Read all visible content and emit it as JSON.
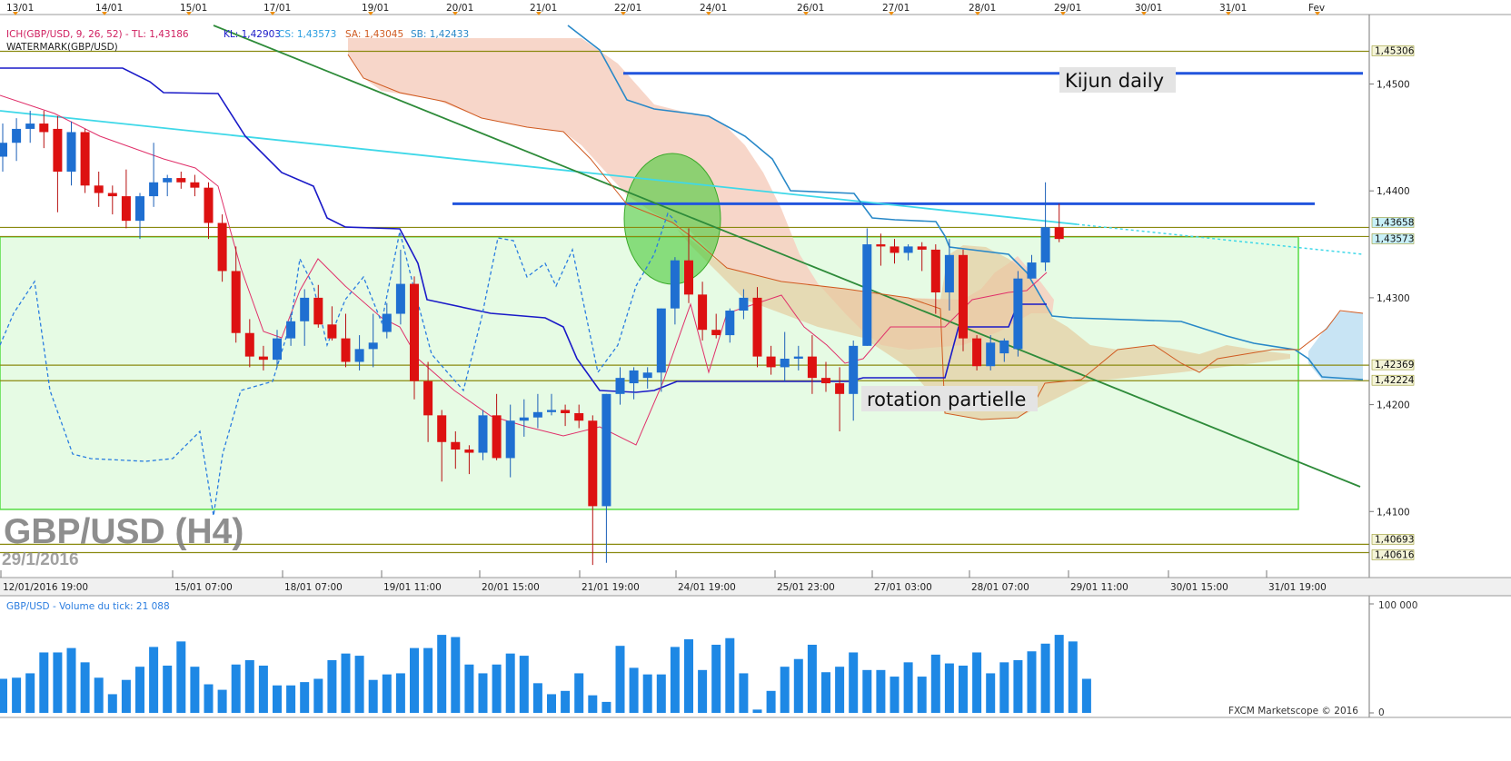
{
  "header": {
    "indicator_ich": "ICH(GBP/USD, 9, 26, 52) - TL: 1,43186",
    "indicator_kl": "KL: 1,42903",
    "indicator_cs": "CS: 1,43573",
    "indicator_sa": "SA: 1,43045",
    "indicator_sb": "SB: 1,42433",
    "watermark": "WATERMARK(GBP/USD)"
  },
  "watermark_text": {
    "title": "GBP/USD (H4)",
    "date": "29/1/2016"
  },
  "annotations": {
    "kijun": "Kijun daily",
    "rotation": "rotation partielle"
  },
  "volume_panel": {
    "label": "GBP/USD - Volume du tick: 21 088",
    "copyright": "FXCM Marketscope © 2016"
  },
  "colors": {
    "up": "#1f6fd1",
    "down": "#dd1111",
    "tenkan": "#e0306a",
    "kijun": "#1a1ac8",
    "chikou": "#2a7de0",
    "ssa": "#d05a20",
    "ssb": "#2888c8",
    "volume": "#1e88e5",
    "hline": "#8a8a10",
    "trend_green": "#2e8b3a",
    "trend_cyan": "#3fd8e8"
  },
  "chart_data": {
    "type": "candlestick",
    "title": "GBP/USD (H4)",
    "ylim": [
      1.4045,
      1.4565
    ],
    "top_dates": [
      "13/01",
      "14/01",
      "15/01",
      "17/01",
      "19/01",
      "20/01",
      "21/01",
      "22/01",
      "24/01",
      "26/01",
      "27/01",
      "28/01",
      "29/01",
      "30/01",
      "31/01",
      "Fev"
    ],
    "bottom_times": [
      "12/01/2016 19:00",
      "15/01 07:00",
      "18/01 07:00",
      "19/01 11:00",
      "20/01 15:00",
      "21/01 19:00",
      "24/01 19:00",
      "25/01 23:00",
      "27/01 03:00",
      "28/01 07:00",
      "29/01 11:00",
      "30/01 15:00",
      "31/01 19:00"
    ],
    "y_ticks": [
      "1,4500",
      "1,4400",
      "1,4300",
      "1,4200",
      "1,4100"
    ],
    "price_levels": [
      {
        "label": "1,45306",
        "value": 1.45306
      },
      {
        "label": "1,43658",
        "value": 1.43658
      },
      {
        "label": "1,43573",
        "value": 1.43573
      },
      {
        "label": "1,42369",
        "value": 1.42369
      },
      {
        "label": "1,42224",
        "value": 1.42224
      },
      {
        "label": "1,40693",
        "value": 1.40693
      },
      {
        "label": "1,40616",
        "value": 1.40616
      }
    ],
    "kijun_daily_levels": [
      1.451,
      1.4388
    ],
    "candles": [
      [
        1.4432,
        1.4463,
        1.4418,
        1.4445
      ],
      [
        1.4445,
        1.4468,
        1.4428,
        1.4458
      ],
      [
        1.4458,
        1.4475,
        1.4445,
        1.4463
      ],
      [
        1.4463,
        1.4475,
        1.444,
        1.4455
      ],
      [
        1.4458,
        1.447,
        1.438,
        1.4418
      ],
      [
        1.4418,
        1.4465,
        1.4405,
        1.4455
      ],
      [
        1.4455,
        1.4458,
        1.4398,
        1.4405
      ],
      [
        1.4405,
        1.4418,
        1.4385,
        1.4398
      ],
      [
        1.4398,
        1.4405,
        1.4378,
        1.4395
      ],
      [
        1.4395,
        1.442,
        1.4365,
        1.4372
      ],
      [
        1.4372,
        1.4398,
        1.4355,
        1.4395
      ],
      [
        1.4395,
        1.4445,
        1.4385,
        1.4408
      ],
      [
        1.4408,
        1.4415,
        1.4395,
        1.4412
      ],
      [
        1.4412,
        1.4418,
        1.4402,
        1.4408
      ],
      [
        1.4408,
        1.4415,
        1.4395,
        1.4403
      ],
      [
        1.4403,
        1.4408,
        1.4355,
        1.437
      ],
      [
        1.437,
        1.4378,
        1.4315,
        1.4325
      ],
      [
        1.4325,
        1.4348,
        1.4258,
        1.4267
      ],
      [
        1.4267,
        1.428,
        1.4235,
        1.4245
      ],
      [
        1.4245,
        1.4255,
        1.4232,
        1.4242
      ],
      [
        1.4242,
        1.427,
        1.4235,
        1.4262
      ],
      [
        1.4262,
        1.4285,
        1.4255,
        1.4278
      ],
      [
        1.4278,
        1.4308,
        1.4255,
        1.43
      ],
      [
        1.43,
        1.4312,
        1.4272,
        1.4275
      ],
      [
        1.4275,
        1.4292,
        1.426,
        1.4262
      ],
      [
        1.4262,
        1.4285,
        1.4235,
        1.424
      ],
      [
        1.424,
        1.4265,
        1.4232,
        1.4252
      ],
      [
        1.4252,
        1.4285,
        1.4235,
        1.4258
      ],
      [
        1.4268,
        1.4295,
        1.4262,
        1.4285
      ],
      [
        1.4285,
        1.4345,
        1.4275,
        1.4313
      ],
      [
        1.4313,
        1.432,
        1.4205,
        1.4222
      ],
      [
        1.4222,
        1.424,
        1.4165,
        1.419
      ],
      [
        1.419,
        1.4195,
        1.4128,
        1.4165
      ],
      [
        1.4165,
        1.4175,
        1.414,
        1.4158
      ],
      [
        1.4158,
        1.4162,
        1.4135,
        1.4155
      ],
      [
        1.4155,
        1.4195,
        1.4148,
        1.419
      ],
      [
        1.419,
        1.421,
        1.4148,
        1.415
      ],
      [
        1.415,
        1.42,
        1.4132,
        1.4185
      ],
      [
        1.4185,
        1.4205,
        1.417,
        1.4188
      ],
      [
        1.4188,
        1.421,
        1.4178,
        1.4193
      ],
      [
        1.4193,
        1.421,
        1.419,
        1.4195
      ],
      [
        1.4195,
        1.42,
        1.418,
        1.4192
      ],
      [
        1.4192,
        1.42,
        1.4178,
        1.4185
      ],
      [
        1.4185,
        1.419,
        1.405,
        1.4105
      ],
      [
        1.4105,
        1.421,
        1.4052,
        1.421
      ],
      [
        1.421,
        1.4235,
        1.42,
        1.4225
      ],
      [
        1.422,
        1.4235,
        1.4205,
        1.4232
      ],
      [
        1.4225,
        1.4235,
        1.4215,
        1.423
      ],
      [
        1.423,
        1.429,
        1.4212,
        1.429
      ],
      [
        1.429,
        1.4338,
        1.4275,
        1.4335
      ],
      [
        1.4335,
        1.4365,
        1.4295,
        1.4303
      ],
      [
        1.4303,
        1.4315,
        1.426,
        1.427
      ],
      [
        1.427,
        1.4285,
        1.4262,
        1.4265
      ],
      [
        1.4265,
        1.429,
        1.4258,
        1.4288
      ],
      [
        1.4288,
        1.4308,
        1.428,
        1.43
      ],
      [
        1.43,
        1.431,
        1.4235,
        1.4245
      ],
      [
        1.4245,
        1.4255,
        1.4228,
        1.4235
      ],
      [
        1.4235,
        1.4268,
        1.4222,
        1.4243
      ],
      [
        1.4243,
        1.4255,
        1.4232,
        1.4245
      ],
      [
        1.4245,
        1.4265,
        1.421,
        1.4225
      ],
      [
        1.4225,
        1.424,
        1.4212,
        1.422
      ],
      [
        1.422,
        1.4235,
        1.4175,
        1.421
      ],
      [
        1.421,
        1.426,
        1.4185,
        1.4255
      ],
      [
        1.4255,
        1.4365,
        1.4255,
        1.435
      ],
      [
        1.435,
        1.436,
        1.433,
        1.4348
      ],
      [
        1.4348,
        1.4355,
        1.4332,
        1.4342
      ],
      [
        1.4342,
        1.435,
        1.4335,
        1.4348
      ],
      [
        1.4348,
        1.4352,
        1.4325,
        1.4345
      ],
      [
        1.4345,
        1.435,
        1.4285,
        1.4305
      ],
      [
        1.4305,
        1.4355,
        1.4288,
        1.434
      ],
      [
        1.434,
        1.4345,
        1.425,
        1.4262
      ],
      [
        1.4262,
        1.4265,
        1.4232,
        1.4236
      ],
      [
        1.4236,
        1.4265,
        1.4232,
        1.4258
      ],
      [
        1.4248,
        1.4262,
        1.424,
        1.426
      ],
      [
        1.4252,
        1.4325,
        1.4245,
        1.4318
      ],
      [
        1.4318,
        1.434,
        1.4318,
        1.4333
      ],
      [
        1.4333,
        1.4408,
        1.4325,
        1.4366
      ],
      [
        1.4366,
        1.4388,
        1.4352,
        1.4355
      ]
    ],
    "volume_max_label": "100 000",
    "volume_zero_label": "0",
    "volumes": [
      31,
      32,
      36,
      55,
      55,
      59,
      46,
      32,
      17,
      30,
      42,
      60,
      43,
      65,
      42,
      26,
      21,
      44,
      48,
      43,
      25,
      25,
      28,
      31,
      48,
      54,
      52,
      30,
      35,
      36,
      59,
      59,
      71,
      69,
      44,
      36,
      44,
      54,
      52,
      27,
      17,
      20,
      36,
      16,
      10,
      61,
      41,
      35,
      35,
      60,
      67,
      39,
      62,
      68,
      36,
      3,
      20,
      42,
      49,
      62,
      37,
      42,
      55,
      39,
      39,
      33,
      46,
      33,
      53,
      45,
      43,
      55,
      36,
      46,
      48,
      56,
      63,
      71,
      65,
      31
    ]
  }
}
